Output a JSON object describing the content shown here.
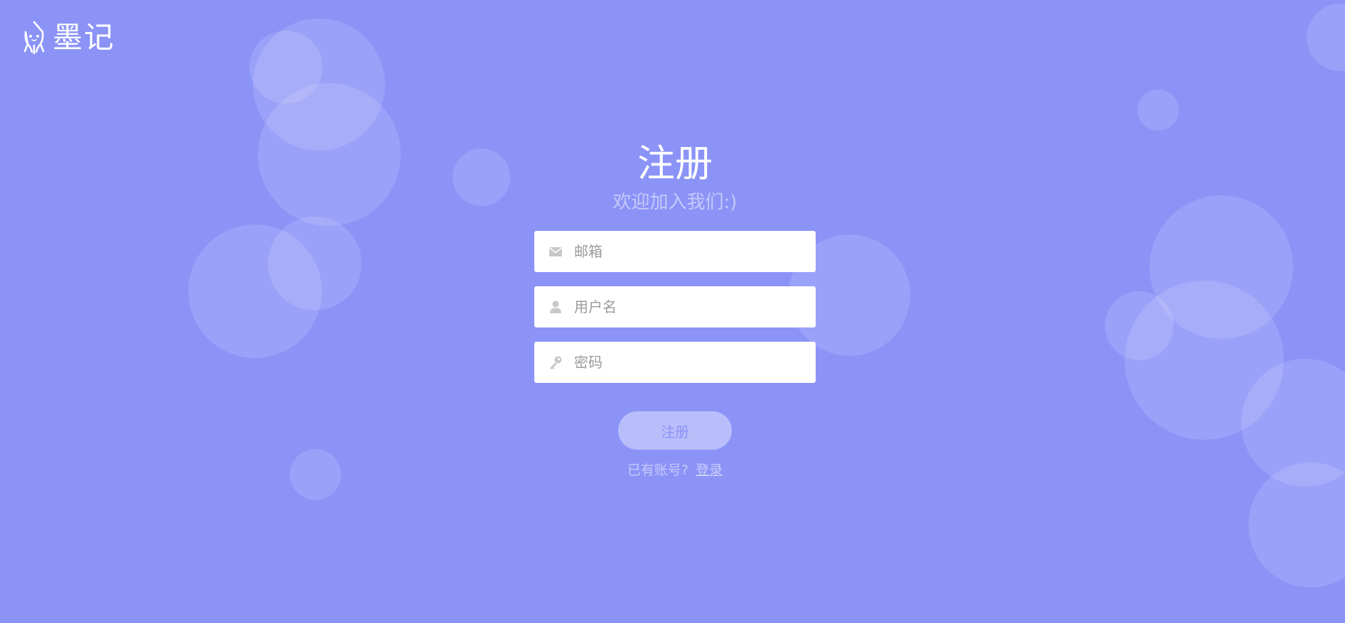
{
  "brand": {
    "name": "墨记",
    "icon": "squid-mascot-icon"
  },
  "form": {
    "title": "注册",
    "subtitle": "欢迎加入我们:)",
    "email": {
      "placeholder": "邮箱",
      "icon": "envelope-icon",
      "value": ""
    },
    "username": {
      "placeholder": "用户名",
      "icon": "user-icon",
      "value": ""
    },
    "password": {
      "placeholder": "密码",
      "icon": "key-icon",
      "value": ""
    },
    "submit_label": "注册",
    "login_prompt": "已有账号?",
    "login_link": "登录"
  },
  "colors": {
    "background": "#8b93f7",
    "field_bg": "#ffffff",
    "icon_gray": "#c8c8c8"
  }
}
